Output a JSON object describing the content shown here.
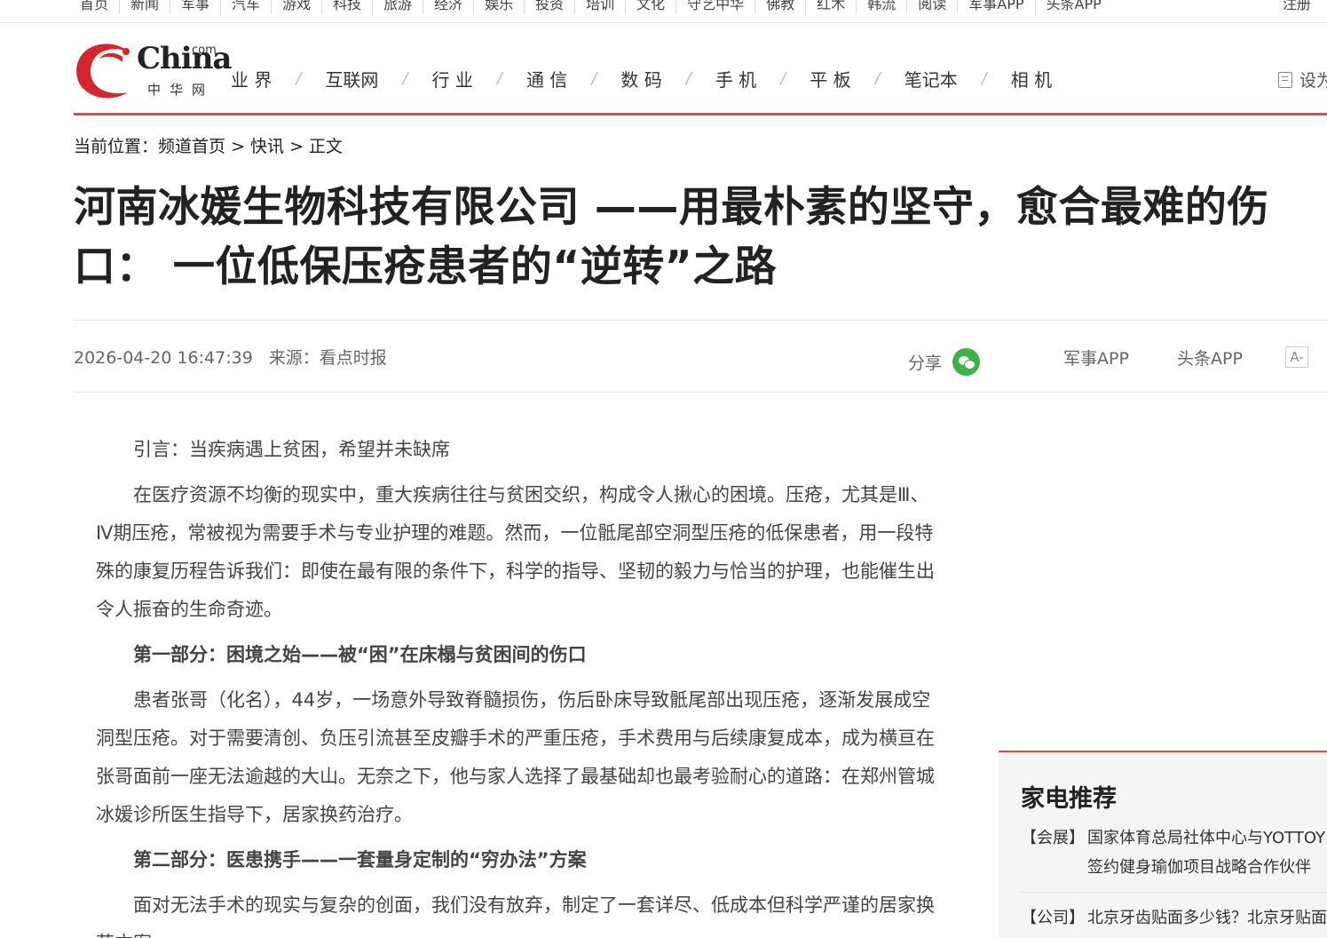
{
  "topnav": {
    "items": [
      "首页",
      "新闻",
      "军事",
      "汽车",
      "游戏",
      "科技",
      "旅游",
      "经济",
      "娱乐",
      "投资",
      "培训",
      "文化",
      "守艺中华",
      "佛教",
      "红木",
      "韩流",
      "阅读",
      "军事APP",
      "头条APP"
    ],
    "register": "注册"
  },
  "logo": {
    "brand": "China",
    "com": "com",
    "cn": "中华网"
  },
  "mainnav": {
    "items": [
      "业 界",
      "互联网",
      "行 业",
      "通 信",
      "数 码",
      "手 机",
      "平 板",
      "笔记本",
      "相 机"
    ],
    "separator": "/"
  },
  "settings": {
    "label": "设为"
  },
  "breadcrumb": {
    "prefix": "当前位置：",
    "home": "频道首页",
    "sep": " > ",
    "section": "快讯",
    "current": "正文"
  },
  "article": {
    "title": "河南冰媛生物科技有限公司 ——用最朴素的坚守，愈合最难的伤口： 一位低保压疮患者的“逆转”之路",
    "datetime": "2026-04-20 16:47:39",
    "source": "来源：看点时报",
    "paragraphs": [
      {
        "type": "text",
        "text": "引言：当疾病遇上贫困，希望并未缺席"
      },
      {
        "type": "text",
        "text": "在医疗资源不均衡的现实中，重大疾病往往与贫困交织，构成令人揪心的困境。压疮，尤其是Ⅲ、Ⅳ期压疮，常被视为需要手术与专业护理的难题。然而，一位骶尾部空洞型压疮的低保患者，用一段特殊的康复历程告诉我们：即使在最有限的条件下，科学的指导、坚韧的毅力与恰当的护理，也能催生出令人振奋的生命奇迹。"
      },
      {
        "type": "head",
        "text": "第一部分：困境之始——被“困”在床榻与贫困间的伤口"
      },
      {
        "type": "text",
        "text": "患者张哥（化名），44岁，一场意外导致脊髓损伤，伤后卧床导致骶尾部出现压疮，逐渐发展成空洞型压疮。对于需要清创、负压引流甚至皮瓣手术的严重压疮，手术费用与后续康复成本，成为横亘在张哥面前一座无法逾越的大山。无奈之下，他与家人选择了最基础却也最考验耐心的道路：在郑州管城冰媛诊所医生指导下，居家换药治疗。"
      },
      {
        "type": "head",
        "text": "第二部分：医患携手——一套量身定制的“穷办法”方案"
      },
      {
        "type": "text",
        "text": "面对无法手术的现实与复杂的创面，我们没有放弃，制定了一套详尽、低成本但科学严谨的居家换药方案。"
      }
    ]
  },
  "share": {
    "label": "分享",
    "icon": "wechat-icon"
  },
  "apps": {
    "app1": "军事APP",
    "app2": "头条APP",
    "font_btn": "A-"
  },
  "sidebar": {
    "title": "家电推荐",
    "entries": [
      {
        "tag": "【会展】",
        "text": "国家体育总局社体中心与YOTTOY签约健身瑜伽项目战略合作伙伴"
      },
      {
        "tag": "【公司】",
        "text": "北京牙齿贴面多少钱？北京牙贴面选"
      }
    ]
  },
  "colors": {
    "accent": "#e24a4a",
    "wechat": "#3cb34a"
  }
}
